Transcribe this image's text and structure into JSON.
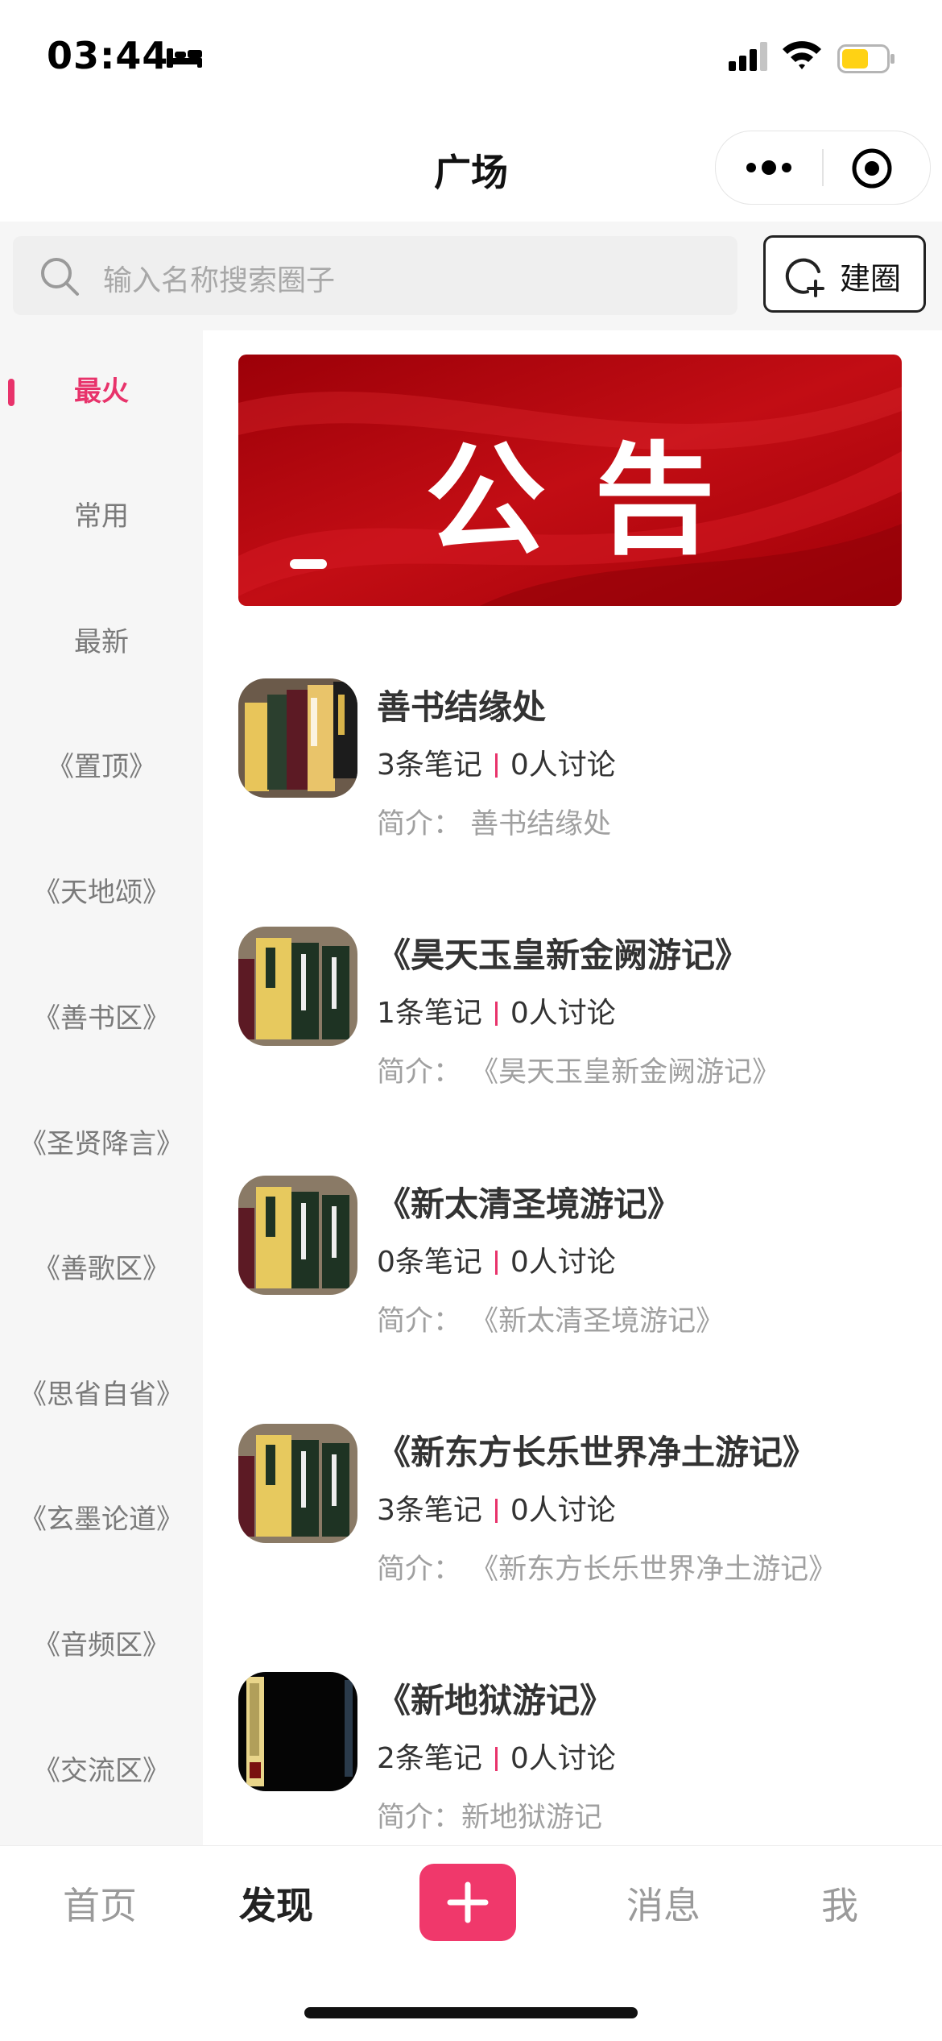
{
  "status_bar": {
    "time": "03:44"
  },
  "nav": {
    "title": "广场"
  },
  "search": {
    "placeholder": "输入名称搜索圈子",
    "create_label": "建圈"
  },
  "sidebar": {
    "items": [
      {
        "label": "最火",
        "active": true
      },
      {
        "label": "常用"
      },
      {
        "label": "最新"
      },
      {
        "label": "《置顶》"
      },
      {
        "label": "《天地颂》"
      },
      {
        "label": "《善书区》"
      },
      {
        "label": "《圣贤降言》"
      },
      {
        "label": "《善歌区》"
      },
      {
        "label": "《思省自省》"
      },
      {
        "label": "《玄墨论道》"
      },
      {
        "label": "《音频区》"
      },
      {
        "label": "《交流区》"
      }
    ]
  },
  "banner": {
    "text": "公告"
  },
  "circles": [
    {
      "name": "善书结缘处",
      "notes": "3条笔记",
      "discussions": "0人讨论",
      "desc": "简介：  善书结缘处"
    },
    {
      "name": "《昊天玉皇新金阙游记》",
      "notes": "1条笔记",
      "discussions": "0人讨论",
      "desc": "简介：  《昊天玉皇新金阙游记》"
    },
    {
      "name": "《新太清圣境游记》",
      "notes": "0条笔记",
      "discussions": "0人讨论",
      "desc": "简介：  《新太清圣境游记》"
    },
    {
      "name": "《新东方长乐世界净土游记》",
      "notes": "3条笔记",
      "discussions": "0人讨论",
      "desc": "简介：  《新东方长乐世界净土游记》"
    },
    {
      "name": "《新地狱游记》",
      "notes": "2条笔记",
      "discussions": "0人讨论",
      "desc": "简介：新地狱游记"
    }
  ],
  "tabbar": {
    "home": "首页",
    "discover": "发现",
    "messages": "消息",
    "me": "我"
  },
  "colors": {
    "accent": "#e8336b",
    "banner_red": "#b5070f"
  }
}
